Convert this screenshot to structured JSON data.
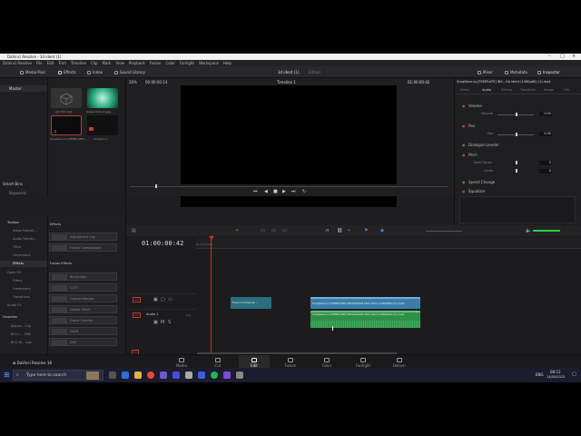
{
  "window": {
    "title": "DaVinci Resolve - 3d ident (1)"
  },
  "menu": [
    "DaVinci Resolve",
    "File",
    "Edit",
    "Trim",
    "Timeline",
    "Clip",
    "Mark",
    "View",
    "Playback",
    "Fusion",
    "Color",
    "Fairlight",
    "Workspace",
    "Help"
  ],
  "toolbar": {
    "media_pool": "Media Pool",
    "effects": "Effects",
    "index": "Index",
    "sound_library": "Sound Library",
    "project_name": "3d ident (1)",
    "edited": "Edited",
    "mixer": "Mixer",
    "metadata": "Metadata",
    "inspector": "Inspector"
  },
  "viewer": {
    "zoom": "26%",
    "timecode_left": "00:00:00:14",
    "timeline_name": "Timeline 1",
    "timecode_right": "01:00:00:42",
    "clip_name": "SnapSave.io-[TEMPLATE] INS...GA ident (1080p60) (1).mp4"
  },
  "bins": {
    "master": "Master",
    "smart_bins": "Smart Bins",
    "keywords": "Keywords"
  },
  "media": [
    {
      "label": "gif_000.mp4"
    },
    {
      "label": "Green shot (1).jpg"
    },
    {
      "label": "SnapSave.io-[TEMPLATE]..."
    },
    {
      "label": "Timeline 1"
    }
  ],
  "effects_sidebar": {
    "items": [
      "Toolbox",
      "Video Transiti...",
      "Audio Transiti...",
      "Titles",
      "Generators",
      "Effects",
      "Open FX",
      "Filters",
      "Generators",
      "Transitions",
      "Audio FX"
    ],
    "favorites": "Favorites",
    "fav_items": [
      "Adjust... Clip",
      "BCC L... OBS",
      "BCC W... Icon"
    ]
  },
  "effects_panel": {
    "section1": "Effects",
    "items1": [
      "Adjustment Clip",
      "Fusion Composition"
    ],
    "section2": "Fusion Effects",
    "items2": [
      "Binoculars",
      "CCTV",
      "Colored Border",
      "Digital Glitch",
      "Drone Overlay",
      "DSLR",
      "DVE"
    ]
  },
  "inspector": {
    "tabs": [
      "Video",
      "Audio",
      "Effects",
      "Transition",
      "Image",
      "File"
    ],
    "volume": "Volume",
    "volume_label": "Volume",
    "volume_value": "0.00",
    "pan": "Pan",
    "pan_label": "Pan",
    "pan_value": "0.00",
    "dialogue": "Dialogue Leveler",
    "pitch": "Pitch",
    "semitones": "Semi Tones",
    "semitones_value": "0",
    "cents": "Cents",
    "cents_value": "0",
    "speed": "Speed Change",
    "equalizer": "Equalizer"
  },
  "timeline": {
    "timecode": "01:00:00:42",
    "ruler_start": "01:00:00:00",
    "v1": "V1",
    "a1": "A1",
    "audio_track": "Audio 1",
    "audio_level": "2.0",
    "clip_fusion": "Fusion Composit...",
    "clip_video": "SnapSave.io-[TEMPLATE] INSTAGRAM ADA ident (1080p60) (1).mp4",
    "clip_audio": "SnapSave.io-[TEMPLATE] INSTAGRAM ADA ident (1080p60) (1).mp4"
  },
  "pages": [
    "Media",
    "Cut",
    "Edit",
    "Fusion",
    "Color",
    "Fairlight",
    "Deliver"
  ],
  "app_footer": "DaVinci Resolve 18",
  "taskbar": {
    "search_placeholder": "Type here to search",
    "lang": "ENG",
    "time": "08:12",
    "date": "14/05/2023"
  }
}
